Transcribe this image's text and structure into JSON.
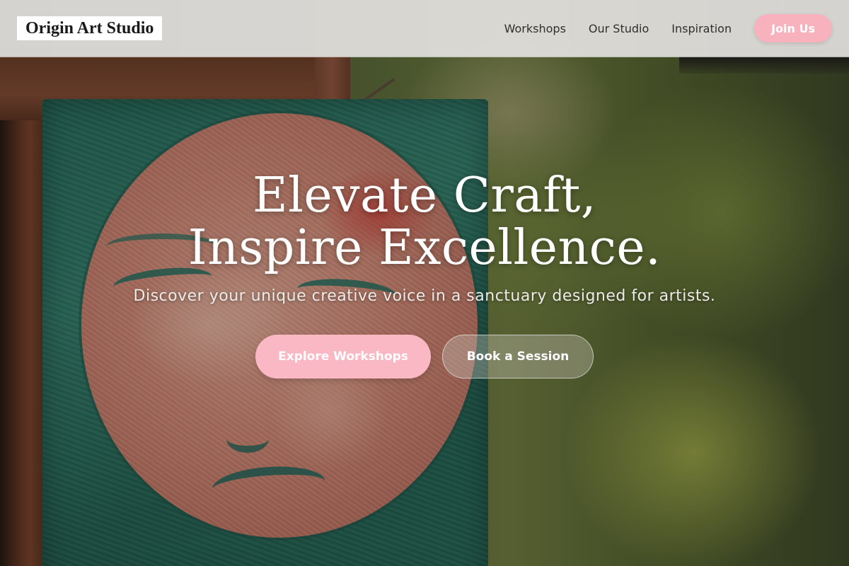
{
  "header": {
    "logo": "Origin Art Studio",
    "nav": [
      "Workshops",
      "Our Studio",
      "Inspiration"
    ],
    "cta": "Join Us"
  },
  "hero": {
    "title_line1": "Elevate Craft,",
    "title_line2": "Inspire Excellence.",
    "subtitle": "Discover your unique creative voice in a sanctuary designed for artists.",
    "primary_cta": "Explore Workshops",
    "secondary_cta": "Book a Session"
  },
  "colors": {
    "accent_pink": "#f9b8c3",
    "header_bg": "#ece8e8",
    "text_dark": "#1a1a1a"
  }
}
